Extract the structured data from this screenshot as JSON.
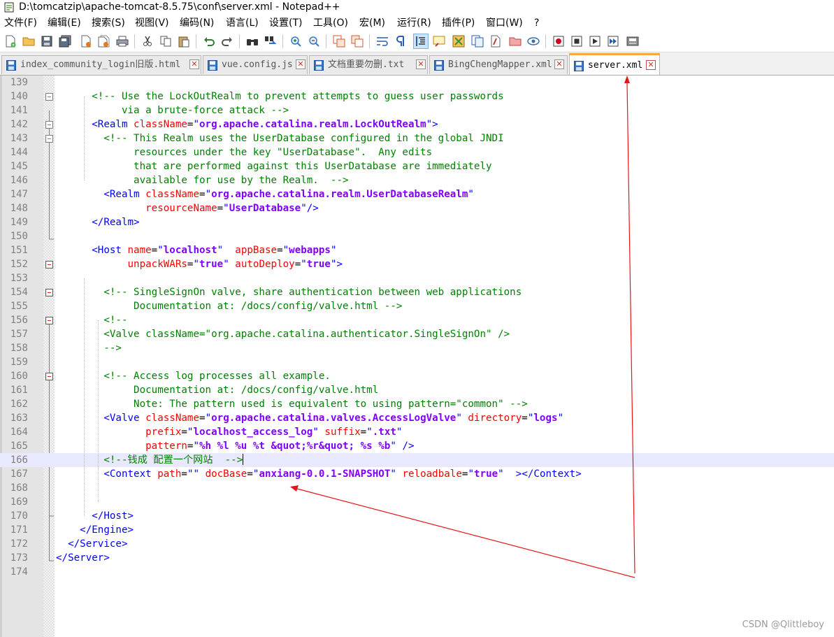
{
  "window": {
    "title": "D:\\tomcatzip\\apache-tomcat-8.5.75\\conf\\server.xml - Notepad++"
  },
  "menu": [
    "文件(F)",
    "编辑(E)",
    "搜索(S)",
    "视图(V)",
    "编码(N)",
    "语言(L)",
    "设置(T)",
    "工具(O)",
    "宏(M)",
    "运行(R)",
    "插件(P)",
    "窗口(W)",
    "?"
  ],
  "toolbar": [
    "new-file-icon",
    "open-folder-icon",
    "save-icon",
    "save-all-icon",
    "close-icon",
    "close-all-icon",
    "print-icon",
    "cut-icon",
    "copy-icon",
    "paste-icon",
    "undo-icon",
    "redo-icon",
    "find-icon",
    "replace-icon",
    "zoom-in-icon",
    "zoom-out-icon",
    "sync-vertical-icon",
    "sync-horizontal-icon",
    "word-wrap-icon",
    "show-all-chars-icon",
    "indent-guide-icon",
    "user-language-icon",
    "doc-map-icon",
    "function-list-icon",
    "doc-list-icon",
    "folder-workspace-icon",
    "monitoring-icon",
    "record-macro-icon",
    "stop-record-icon",
    "play-macro-icon",
    "run-multiple-macro-icon",
    "save-macro-icon"
  ],
  "tabs": [
    {
      "label": "index_community_login旧版.html",
      "active": false
    },
    {
      "label": "vue.config.js",
      "active": false
    },
    {
      "label": "文档重要勿删.txt",
      "active": false
    },
    {
      "label": "BingChengMapper.xml",
      "active": false
    },
    {
      "label": "server.xml",
      "active": true
    }
  ],
  "editor": {
    "current_line": 166,
    "lines": [
      {
        "n": 139,
        "tokens": []
      },
      {
        "n": 140,
        "tokens": [
          [
            "p",
            "      "
          ],
          [
            "c",
            "<!-- Use the LockOutRealm to prevent attempts to guess user passwords"
          ]
        ]
      },
      {
        "n": 141,
        "tokens": [
          [
            "c",
            "           via a brute-force attack -->"
          ]
        ]
      },
      {
        "n": 142,
        "tokens": [
          [
            "p",
            "      "
          ],
          [
            "t",
            "<Realm "
          ],
          [
            "a",
            "className"
          ],
          [
            "p",
            "="
          ],
          [
            "t",
            "\""
          ],
          [
            "v",
            "org.apache.catalina.realm.LockOutRealm"
          ],
          [
            "t",
            "\">"
          ]
        ]
      },
      {
        "n": 143,
        "tokens": [
          [
            "p",
            "        "
          ],
          [
            "c",
            "<!-- This Realm uses the UserDatabase configured in the global JNDI"
          ]
        ]
      },
      {
        "n": 144,
        "tokens": [
          [
            "c",
            "             resources under the key \"UserDatabase\".  Any edits"
          ]
        ]
      },
      {
        "n": 145,
        "tokens": [
          [
            "c",
            "             that are performed against this UserDatabase are immediately"
          ]
        ]
      },
      {
        "n": 146,
        "tokens": [
          [
            "c",
            "             available for use by the Realm.  -->"
          ]
        ]
      },
      {
        "n": 147,
        "tokens": [
          [
            "p",
            "        "
          ],
          [
            "t",
            "<Realm "
          ],
          [
            "a",
            "className"
          ],
          [
            "p",
            "="
          ],
          [
            "t",
            "\""
          ],
          [
            "v",
            "org.apache.catalina.realm.UserDatabaseRealm"
          ],
          [
            "t",
            "\""
          ]
        ]
      },
      {
        "n": 148,
        "tokens": [
          [
            "p",
            "               "
          ],
          [
            "a",
            "resourceName"
          ],
          [
            "p",
            "="
          ],
          [
            "t",
            "\""
          ],
          [
            "v",
            "UserDatabase"
          ],
          [
            "t",
            "\"/>"
          ]
        ]
      },
      {
        "n": 149,
        "tokens": [
          [
            "p",
            "      "
          ],
          [
            "t",
            "</Realm>"
          ]
        ]
      },
      {
        "n": 150,
        "tokens": []
      },
      {
        "n": 151,
        "tokens": [
          [
            "p",
            "      "
          ],
          [
            "t",
            "<Host "
          ],
          [
            "a",
            "name"
          ],
          [
            "p",
            "="
          ],
          [
            "t",
            "\""
          ],
          [
            "v",
            "localhost"
          ],
          [
            "t",
            "\""
          ],
          [
            "p",
            "  "
          ],
          [
            "a",
            "appBase"
          ],
          [
            "p",
            "="
          ],
          [
            "t",
            "\""
          ],
          [
            "v",
            "webapps"
          ],
          [
            "t",
            "\""
          ]
        ]
      },
      {
        "n": 152,
        "tokens": [
          [
            "p",
            "            "
          ],
          [
            "a",
            "unpackWARs"
          ],
          [
            "p",
            "="
          ],
          [
            "t",
            "\""
          ],
          [
            "v",
            "true"
          ],
          [
            "t",
            "\" "
          ],
          [
            "a",
            "autoDeploy"
          ],
          [
            "p",
            "="
          ],
          [
            "t",
            "\""
          ],
          [
            "v",
            "true"
          ],
          [
            "t",
            "\">"
          ]
        ]
      },
      {
        "n": 153,
        "tokens": []
      },
      {
        "n": 154,
        "tokens": [
          [
            "p",
            "        "
          ],
          [
            "c",
            "<!-- SingleSignOn valve, share authentication between web applications"
          ]
        ]
      },
      {
        "n": 155,
        "tokens": [
          [
            "c",
            "             Documentation at: /docs/config/valve.html -->"
          ]
        ]
      },
      {
        "n": 156,
        "tokens": [
          [
            "p",
            "        "
          ],
          [
            "c",
            "<!--"
          ]
        ]
      },
      {
        "n": 157,
        "tokens": [
          [
            "c",
            "        <Valve className=\"org.apache.catalina.authenticator.SingleSignOn\" />"
          ]
        ]
      },
      {
        "n": 158,
        "tokens": [
          [
            "c",
            "        -->"
          ]
        ]
      },
      {
        "n": 159,
        "tokens": []
      },
      {
        "n": 160,
        "tokens": [
          [
            "p",
            "        "
          ],
          [
            "c",
            "<!-- Access log processes all example."
          ]
        ]
      },
      {
        "n": 161,
        "tokens": [
          [
            "c",
            "             Documentation at: /docs/config/valve.html"
          ]
        ]
      },
      {
        "n": 162,
        "tokens": [
          [
            "c",
            "             Note: The pattern used is equivalent to using pattern=\"common\" -->"
          ]
        ]
      },
      {
        "n": 163,
        "tokens": [
          [
            "p",
            "        "
          ],
          [
            "t",
            "<Valve "
          ],
          [
            "a",
            "className"
          ],
          [
            "p",
            "="
          ],
          [
            "t",
            "\""
          ],
          [
            "v",
            "org.apache.catalina.valves.AccessLogValve"
          ],
          [
            "t",
            "\" "
          ],
          [
            "a",
            "directory"
          ],
          [
            "p",
            "="
          ],
          [
            "t",
            "\""
          ],
          [
            "v",
            "logs"
          ],
          [
            "t",
            "\""
          ]
        ]
      },
      {
        "n": 164,
        "tokens": [
          [
            "p",
            "               "
          ],
          [
            "a",
            "prefix"
          ],
          [
            "p",
            "="
          ],
          [
            "t",
            "\""
          ],
          [
            "v",
            "localhost_access_log"
          ],
          [
            "t",
            "\" "
          ],
          [
            "a",
            "suffix"
          ],
          [
            "p",
            "="
          ],
          [
            "t",
            "\""
          ],
          [
            "v",
            ".txt"
          ],
          [
            "t",
            "\""
          ]
        ]
      },
      {
        "n": 165,
        "tokens": [
          [
            "p",
            "               "
          ],
          [
            "a",
            "pattern"
          ],
          [
            "p",
            "="
          ],
          [
            "t",
            "\""
          ],
          [
            "v",
            "%h %l %u %t &quot;%r&quot; %s %b"
          ],
          [
            "t",
            "\" />"
          ]
        ]
      },
      {
        "n": 166,
        "tokens": [
          [
            "p",
            "        "
          ],
          [
            "c",
            "<!--钱成 配置一个网站  -->"
          ]
        ]
      },
      {
        "n": 167,
        "tokens": [
          [
            "p",
            "        "
          ],
          [
            "t",
            "<Context "
          ],
          [
            "a",
            "path"
          ],
          [
            "p",
            "="
          ],
          [
            "t",
            "\"\" "
          ],
          [
            "a",
            "docBase"
          ],
          [
            "p",
            "="
          ],
          [
            "t",
            "\""
          ],
          [
            "v",
            "anxiang-0.0.1-SNAPSHOT"
          ],
          [
            "t",
            "\" "
          ],
          [
            "a",
            "reloadbale"
          ],
          [
            "p",
            "="
          ],
          [
            "t",
            "\""
          ],
          [
            "v",
            "true"
          ],
          [
            "t",
            "\"  ></Context>"
          ]
        ]
      },
      {
        "n": 168,
        "tokens": []
      },
      {
        "n": 169,
        "tokens": []
      },
      {
        "n": 170,
        "tokens": [
          [
            "p",
            "      "
          ],
          [
            "t",
            "</Host>"
          ]
        ]
      },
      {
        "n": 171,
        "tokens": [
          [
            "p",
            "    "
          ],
          [
            "t",
            "</Engine>"
          ]
        ]
      },
      {
        "n": 172,
        "tokens": [
          [
            "p",
            "  "
          ],
          [
            "t",
            "</Service>"
          ]
        ]
      },
      {
        "n": 173,
        "tokens": [
          [
            "t",
            "</Server>"
          ]
        ]
      },
      {
        "n": 174,
        "tokens": []
      }
    ]
  },
  "annotation": {
    "color": "#e8141a"
  },
  "watermark": "CSDN @Qlittleboy"
}
